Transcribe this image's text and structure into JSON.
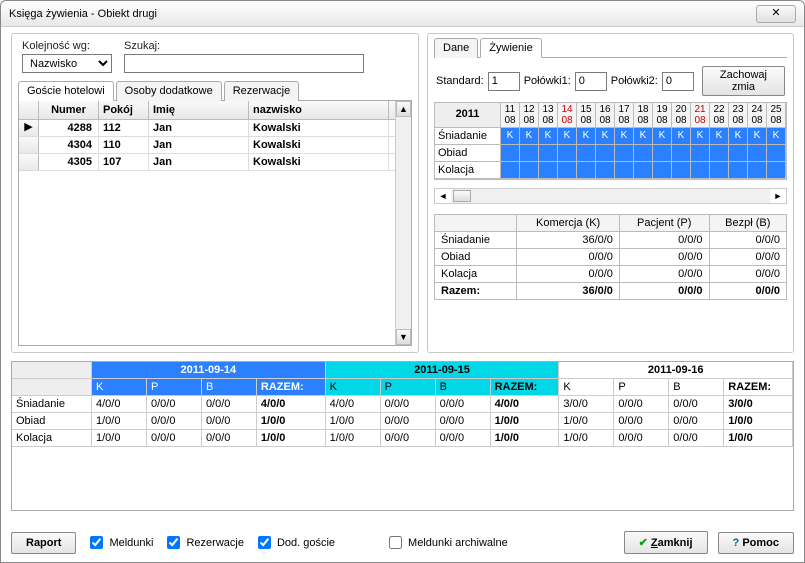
{
  "window": {
    "title": "Księga żywienia - Obiekt drugi",
    "close": "✕"
  },
  "left": {
    "order_label": "Kolejność wg:",
    "order_value": "Nazwisko",
    "search_label": "Szukaj:",
    "search_value": "",
    "tabs": [
      "Goście hotelowi",
      "Osoby dodatkowe",
      "Rezerwacje"
    ],
    "active_tab": 0,
    "columns": {
      "numer": "Numer",
      "pokoj": "Pokój",
      "imie": "Imię",
      "nazwisko": "nazwisko"
    },
    "rows": [
      {
        "numer": "4288",
        "pokoj": "112",
        "imie": "Jan",
        "nazwisko": "Kowalski",
        "current": true
      },
      {
        "numer": "4304",
        "pokoj": "110",
        "imie": "Jan",
        "nazwisko": "Kowalski",
        "current": false
      },
      {
        "numer": "4305",
        "pokoj": "107",
        "imie": "Jan",
        "nazwisko": "Kowalski",
        "current": false
      }
    ]
  },
  "right": {
    "tabs": [
      "Dane",
      "Żywienie"
    ],
    "active_tab": 1,
    "std_label": "Standard:",
    "std_val": "1",
    "pol1_label": "Połówki1:",
    "pol1_val": "0",
    "pol2_label": "Połówki2:",
    "pol2_val": "0",
    "save_btn": "Zachowaj zmia",
    "year": "2011",
    "days": [
      {
        "d": "11",
        "m": "08",
        "red": false
      },
      {
        "d": "12",
        "m": "08",
        "red": false
      },
      {
        "d": "13",
        "m": "08",
        "red": false
      },
      {
        "d": "14",
        "m": "08",
        "red": true
      },
      {
        "d": "15",
        "m": "08",
        "red": false
      },
      {
        "d": "16",
        "m": "08",
        "red": false
      },
      {
        "d": "17",
        "m": "08",
        "red": false
      },
      {
        "d": "18",
        "m": "08",
        "red": false
      },
      {
        "d": "19",
        "m": "08",
        "red": false
      },
      {
        "d": "20",
        "m": "08",
        "red": false
      },
      {
        "d": "21",
        "m": "08",
        "red": true
      },
      {
        "d": "22",
        "m": "08",
        "red": false
      },
      {
        "d": "23",
        "m": "08",
        "red": false
      },
      {
        "d": "24",
        "m": "08",
        "red": false
      },
      {
        "d": "25",
        "m": "08",
        "red": false
      }
    ],
    "meal_rows": [
      "Śniadanie",
      "Obiad",
      "Kolacja"
    ],
    "cell_val": "K",
    "summary": {
      "headers": [
        "",
        "Komercja (K)",
        "Pacjent (P)",
        "Bezpł (B)"
      ],
      "rows": [
        {
          "label": "Śniadanie",
          "k": "36/0/0",
          "p": "0/0/0",
          "b": "0/0/0"
        },
        {
          "label": "Obiad",
          "k": "0/0/0",
          "p": "0/0/0",
          "b": "0/0/0"
        },
        {
          "label": "Kolacja",
          "k": "0/0/0",
          "p": "0/0/0",
          "b": "0/0/0"
        }
      ],
      "totals": {
        "label": "Razem:",
        "k": "36/0/0",
        "p": "0/0/0",
        "b": "0/0/0"
      }
    }
  },
  "bottom": {
    "days": [
      "2011-09-14",
      "2011-09-15",
      "2011-09-16"
    ],
    "sub_headers": [
      "K",
      "P",
      "B",
      "RAZEM:"
    ],
    "rows": [
      {
        "label": "Śniadanie",
        "vals": [
          [
            "4/0/0",
            "0/0/0",
            "0/0/0",
            "4/0/0"
          ],
          [
            "4/0/0",
            "0/0/0",
            "0/0/0",
            "4/0/0"
          ],
          [
            "3/0/0",
            "0/0/0",
            "0/0/0",
            "3/0/0"
          ]
        ]
      },
      {
        "label": "Obiad",
        "vals": [
          [
            "1/0/0",
            "0/0/0",
            "0/0/0",
            "1/0/0"
          ],
          [
            "1/0/0",
            "0/0/0",
            "0/0/0",
            "1/0/0"
          ],
          [
            "1/0/0",
            "0/0/0",
            "0/0/0",
            "1/0/0"
          ]
        ]
      },
      {
        "label": "Kolacja",
        "vals": [
          [
            "1/0/0",
            "0/0/0",
            "0/0/0",
            "1/0/0"
          ],
          [
            "1/0/0",
            "0/0/0",
            "0/0/0",
            "1/0/0"
          ],
          [
            "1/0/0",
            "0/0/0",
            "0/0/0",
            "1/0/0"
          ]
        ]
      }
    ]
  },
  "footer": {
    "raport": "Raport",
    "cb1": "Meldunki",
    "cb2": "Rezerwacje",
    "cb3": "Dod. goście",
    "cb4": "Meldunki archiwalne",
    "zamknij": "Zamknij",
    "pomoc": "Pomoc"
  }
}
